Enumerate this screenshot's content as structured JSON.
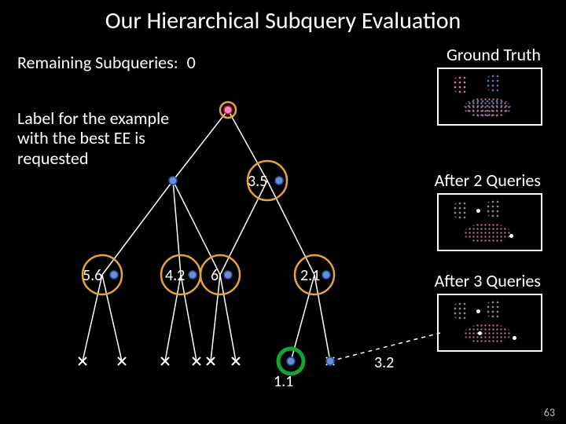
{
  "title": "Our Hierarchical Subquery Evaluation",
  "remaining": {
    "label": "Remaining Subqueries:",
    "value": "0"
  },
  "corner": {
    "ground": "Ground Truth",
    "after2": "After 2 Queries",
    "after3": "After 3 Queries"
  },
  "annotation": "Label for the example with the best EE is requested",
  "nodes": {
    "n35": "3.5",
    "n56": "5.6",
    "n42": "4.2",
    "n6": "6",
    "n21": "2.1",
    "n11": "1.1",
    "n32": "3.2"
  },
  "slide_num": "63",
  "colors": {
    "dashed": "#ffffff",
    "edge": "#ffffff",
    "ring": "#e5a43b",
    "green": "#17a32f",
    "pink": "#ff7ec6",
    "blue": "#6a8fd6",
    "rose": "#d27a8f",
    "steel": "#5a79b0"
  }
}
